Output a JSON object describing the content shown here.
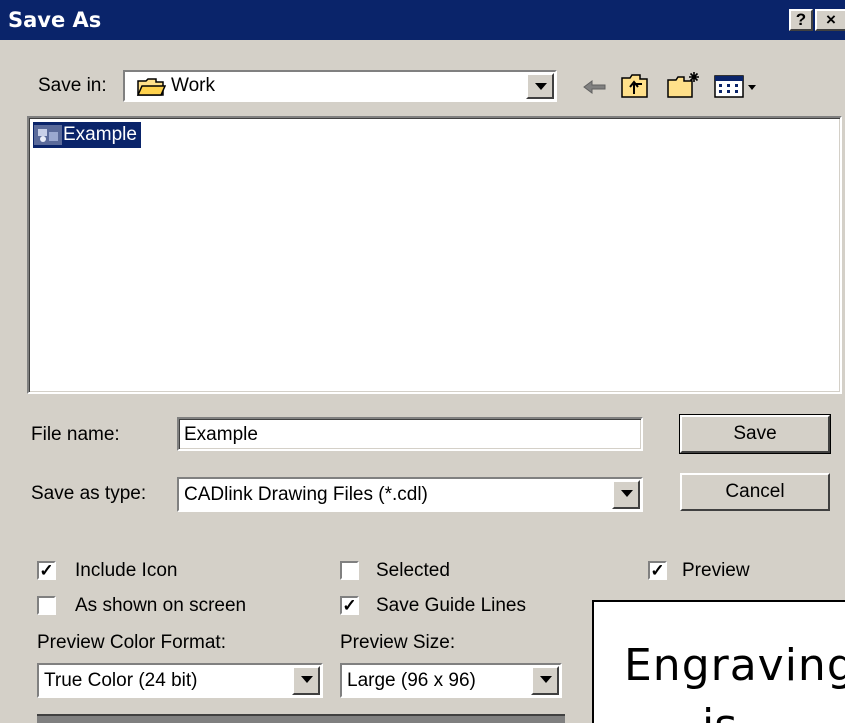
{
  "window": {
    "title": "Save As",
    "help_label": "?",
    "close_label": "×"
  },
  "toolbar": {
    "save_in_label": "Save in:",
    "save_in_value": "Work",
    "icons": [
      "back-arrow-icon",
      "up-folder-icon",
      "new-folder-icon",
      "view-menu-icon"
    ]
  },
  "files": [
    {
      "name": "Example",
      "selected": true
    }
  ],
  "form": {
    "file_name_label": "File name:",
    "file_name_value": "Example",
    "save_as_type_label": "Save as type:",
    "save_as_type_value": "CADlink Drawing Files (*.cdl)",
    "save_button": "Save",
    "cancel_button": "Cancel"
  },
  "options": {
    "include_icon": {
      "label": "Include Icon",
      "checked": true
    },
    "as_shown": {
      "label": "As shown on screen",
      "checked": false
    },
    "selected": {
      "label": "Selected",
      "checked": false
    },
    "save_guide_lines": {
      "label": "Save Guide Lines",
      "checked": true
    },
    "preview": {
      "label": "Preview",
      "checked": true
    },
    "preview_color_label": "Preview Color Format:",
    "preview_color_value": "True Color (24 bit)",
    "preview_size_label": "Preview Size:",
    "preview_size_value": "Large (96 x 96)"
  },
  "preview_panel": {
    "line1": "Engraving",
    "line2": "is"
  },
  "colors": {
    "titlebar": "#0a246a",
    "face": "#d4d0c8",
    "selection": "#0a246a"
  }
}
